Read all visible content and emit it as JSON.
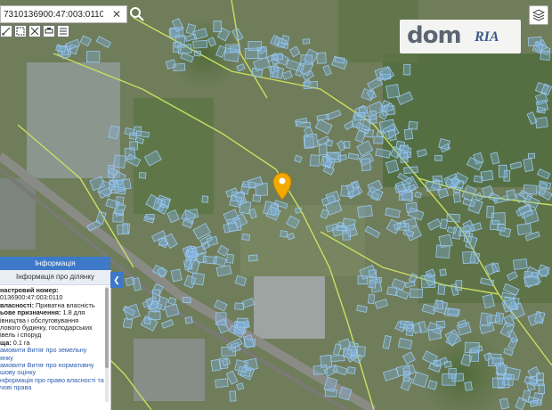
{
  "search": {
    "value": "7310136900:47:003:0110",
    "close_glyph": "✕",
    "search_icon": "search-icon"
  },
  "tools": [
    "measure-icon",
    "select-icon",
    "zoom-icon",
    "print-icon",
    "layers-list-icon"
  ],
  "logo": {
    "dom": "dom",
    "ria": "RIA"
  },
  "map": {
    "marker_color": "#f2a900",
    "parcel_outline": "#9cc8ee",
    "parcel_fill": "rgba(130,180,230,0.35)",
    "boundary_color": "#c8e060"
  },
  "panel": {
    "header": "Інформація",
    "subheader": "Інформація про ділянку",
    "rows": {
      "cadastral_label": "настровий номер:",
      "cadastral_value": "0136900:47:003:0110",
      "ownership_label": "власності:",
      "ownership_value": " Приватна власність",
      "purpose_label": "ьове призначення:",
      "purpose_value": " 1.8 для",
      "purpose_line2": "івництва і обслуговування",
      "purpose_line3": "лового будинку, господарських",
      "purpose_line4": "івель і споруд",
      "area_label": "ща:",
      "area_value": " 0.1 га"
    },
    "links": [
      "амовити Витяг про земельну",
      "янку",
      "амовити Витяг про нормативну",
      "шову оцінку",
      "нформація про право власності та",
      "чові права"
    ]
  },
  "collapse_glyph": "❮",
  "layers_icon": "layers-icon"
}
